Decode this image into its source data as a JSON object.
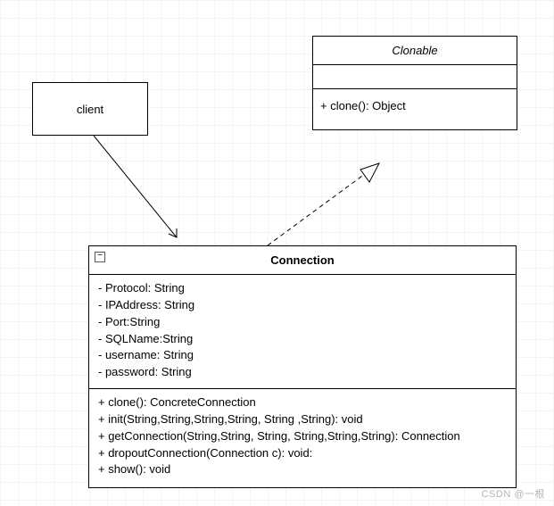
{
  "client": {
    "label": "client"
  },
  "clonable": {
    "title": "Clonable",
    "ops": [
      "+ clone(): Object"
    ]
  },
  "connection": {
    "title": "Connection",
    "collapse_glyph": "−",
    "attrs": [
      "- Protocol: String",
      "- IPAddress: String",
      "- Port:String",
      "- SQLName:String",
      "- username: String",
      "- password: String"
    ],
    "ops": [
      "+ clone(): ConcreteConnection",
      "+ init(String,String,String,String, String ,String): void",
      "+ getConnection(String,String, String, String,String,String): Connection",
      "+ dropoutConnection(Connection c): void:",
      "+ show(): void"
    ]
  },
  "watermark": "CSDN @一根"
}
